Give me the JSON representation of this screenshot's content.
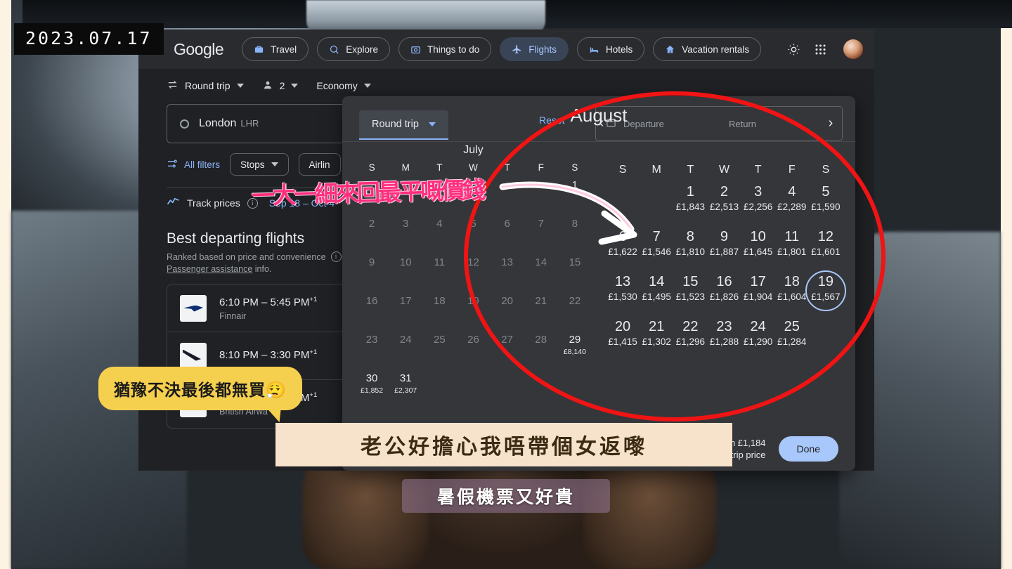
{
  "video": {
    "date_stamp": "2023.07.17",
    "captions": {
      "handwritten_note": "一大一細來回最平嘅價錢",
      "speech_bubble": "猶豫不決最後都無買😮‍💨",
      "subtitle_main": "老公好擔心我唔帶個女返嚟",
      "subtitle_secondary": "暑假機票又好貴"
    }
  },
  "topnav": {
    "logo": "Google",
    "items": [
      {
        "label": "Travel",
        "icon": "suitcase-icon",
        "active": false
      },
      {
        "label": "Explore",
        "icon": "explore-icon",
        "active": false
      },
      {
        "label": "Things to do",
        "icon": "camera-icon",
        "active": false
      },
      {
        "label": "Flights",
        "icon": "plane-icon",
        "active": true
      },
      {
        "label": "Hotels",
        "icon": "bed-icon",
        "active": false
      },
      {
        "label": "Vacation rentals",
        "icon": "house-icon",
        "active": false
      }
    ],
    "actions": [
      {
        "name": "theme-toggle",
        "icon": "brightness-icon"
      },
      {
        "name": "apps-grid",
        "icon": "apps-grid-icon"
      },
      {
        "name": "account-avatar",
        "icon": "avatar"
      }
    ]
  },
  "search": {
    "trip_type": "Round trip",
    "passengers": "2",
    "cabin_class": "Economy",
    "origin": {
      "city": "London",
      "code": "LHR"
    }
  },
  "filters": {
    "all_filters": "All filters",
    "chips": [
      "Stops",
      "Airlin"
    ]
  },
  "track": {
    "label": "Track prices",
    "dates": "Sep 18 – Oct 4"
  },
  "best": {
    "heading": "Best departing flights",
    "subtitle": "Ranked based on price and convenience",
    "subtitle2_link": "Passenger assistance",
    "subtitle2_rest": " info."
  },
  "flights": [
    {
      "times": "6:10 PM – 5:45 PM",
      "plus": "+1",
      "airline": "Finnair",
      "logo": "finnair"
    },
    {
      "times": "8:10 PM – 3:30 PM",
      "plus": "+1",
      "airline": "",
      "logo": "ay2"
    },
    {
      "times": "6:00 PM – 1:40 PM",
      "plus": "+1",
      "airline": "British Airwa",
      "logo": "ba"
    }
  ],
  "calendar": {
    "trip_type": "Round trip",
    "reset_label": "Reset",
    "departure_placeholder": "Departure",
    "return_placeholder": "Return",
    "nav": {
      "prev": "‹",
      "next": "›"
    },
    "footer_line1": "om £1,184",
    "footer_line2": "nd trip price",
    "done_label": "Done",
    "currency": "£",
    "selected_day": "19",
    "months": [
      {
        "name": "July",
        "dow": [
          "S",
          "M",
          "T",
          "W",
          "T",
          "F",
          "S"
        ],
        "lead_blanks": 6,
        "days": [
          {
            "d": "1",
            "price": "",
            "dim": false
          },
          {
            "d": "2",
            "price": "",
            "dim": true
          },
          {
            "d": "3",
            "price": "",
            "dim": true
          },
          {
            "d": "4",
            "price": "",
            "dim": true
          },
          {
            "d": "5",
            "price": "",
            "dim": true
          },
          {
            "d": "6",
            "price": "",
            "dim": true
          },
          {
            "d": "7",
            "price": "",
            "dim": true
          },
          {
            "d": "8",
            "price": "",
            "dim": true
          },
          {
            "d": "9",
            "price": "",
            "dim": true
          },
          {
            "d": "10",
            "price": "",
            "dim": true
          },
          {
            "d": "11",
            "price": "",
            "dim": true
          },
          {
            "d": "12",
            "price": "",
            "dim": true
          },
          {
            "d": "13",
            "price": "",
            "dim": true
          },
          {
            "d": "14",
            "price": "",
            "dim": true
          },
          {
            "d": "15",
            "price": "",
            "dim": true
          },
          {
            "d": "16",
            "price": "",
            "dim": true
          },
          {
            "d": "17",
            "price": "",
            "dim": true
          },
          {
            "d": "18",
            "price": "",
            "dim": true
          },
          {
            "d": "19",
            "price": "",
            "dim": true
          },
          {
            "d": "20",
            "price": "",
            "dim": true
          },
          {
            "d": "21",
            "price": "",
            "dim": true
          },
          {
            "d": "22",
            "price": "",
            "dim": true
          },
          {
            "d": "23",
            "price": "",
            "dim": true
          },
          {
            "d": "24",
            "price": "",
            "dim": true
          },
          {
            "d": "25",
            "price": "",
            "dim": true
          },
          {
            "d": "26",
            "price": "",
            "dim": true
          },
          {
            "d": "27",
            "price": "",
            "dim": true
          },
          {
            "d": "28",
            "price": "",
            "dim": true
          },
          {
            "d": "29",
            "price": "£8,140",
            "dim": false
          },
          {
            "d": "30",
            "price": "£1,852",
            "dim": false
          },
          {
            "d": "31",
            "price": "£2,307",
            "dim": false
          }
        ]
      },
      {
        "name": "August",
        "dow": [
          "S",
          "M",
          "T",
          "W",
          "T",
          "F",
          "S"
        ],
        "lead_blanks": 2,
        "days": [
          {
            "d": "1",
            "price": "£1,843",
            "dim": false
          },
          {
            "d": "2",
            "price": "£2,513",
            "dim": false
          },
          {
            "d": "3",
            "price": "£2,256",
            "dim": false
          },
          {
            "d": "4",
            "price": "£2,289",
            "dim": false
          },
          {
            "d": "5",
            "price": "£1,590",
            "dim": false
          },
          {
            "d": "6",
            "price": "£1,622",
            "dim": false
          },
          {
            "d": "7",
            "price": "£1,546",
            "dim": false
          },
          {
            "d": "8",
            "price": "£1,810",
            "dim": false
          },
          {
            "d": "9",
            "price": "£1,887",
            "dim": false
          },
          {
            "d": "10",
            "price": "£1,645",
            "dim": false
          },
          {
            "d": "11",
            "price": "£1,801",
            "dim": false
          },
          {
            "d": "12",
            "price": "£1,601",
            "dim": false
          },
          {
            "d": "13",
            "price": "£1,530",
            "dim": false
          },
          {
            "d": "14",
            "price": "£1,495",
            "dim": false
          },
          {
            "d": "15",
            "price": "£1,523",
            "dim": false
          },
          {
            "d": "16",
            "price": "£1,826",
            "dim": false
          },
          {
            "d": "17",
            "price": "£1,904",
            "dim": false
          },
          {
            "d": "18",
            "price": "£1,604",
            "dim": false
          },
          {
            "d": "19",
            "price": "£1,567",
            "dim": false,
            "selected": true
          },
          {
            "d": "20",
            "price": "£1,415",
            "dim": false
          },
          {
            "d": "21",
            "price": "£1,302",
            "dim": false
          },
          {
            "d": "22",
            "price": "£1,296",
            "dim": false
          },
          {
            "d": "23",
            "price": "£1,288",
            "dim": false
          },
          {
            "d": "24",
            "price": "£1,290",
            "dim": false
          },
          {
            "d": "25",
            "price": "£1,284",
            "dim": false
          }
        ]
      }
    ]
  }
}
